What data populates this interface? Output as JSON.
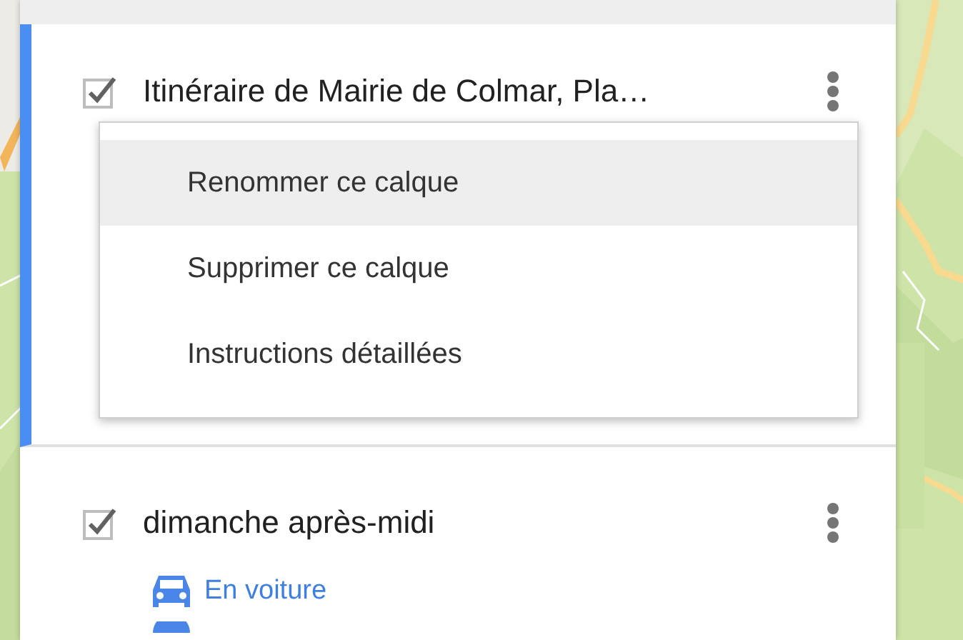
{
  "layers": [
    {
      "title": "Itinéraire de Mairie de Colmar, Pla…",
      "checked": true,
      "selected": true
    },
    {
      "title": "dimanche après-midi",
      "checked": true,
      "selected": false,
      "mode": "En voiture"
    }
  ],
  "menu": {
    "items": [
      {
        "label": "Renommer ce calque",
        "selected": true
      },
      {
        "label": "Supprimer ce calque",
        "selected": false
      },
      {
        "label": "Instructions détaillées",
        "selected": false
      }
    ]
  }
}
